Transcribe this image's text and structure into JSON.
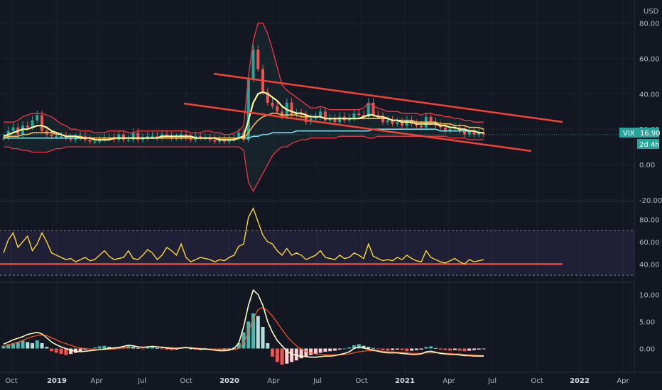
{
  "chart_data": [
    {
      "type": "candlestick",
      "pane": "price",
      "currency": "USD",
      "ylim": [
        -20,
        85
      ],
      "yticks": [
        -20,
        0,
        20,
        40,
        60,
        80
      ],
      "ytick_labels": [
        "-20.00",
        "0.00",
        "20.00",
        "40.00",
        "60.00",
        "80.00"
      ],
      "last_value_symbol": "VIX",
      "last_value": "16.90",
      "time_to_close": "2d 4h",
      "series": [
        {
          "name": "close",
          "values": [
            15,
            19,
            21,
            17,
            22,
            21,
            25,
            28,
            19,
            17,
            16,
            16,
            16,
            15,
            14,
            15,
            16,
            14,
            13,
            13,
            14,
            15,
            15,
            14,
            17,
            14,
            14,
            18,
            14,
            15,
            16,
            16,
            15,
            17,
            16,
            15,
            15,
            17,
            15,
            14,
            16,
            15,
            15,
            14,
            13,
            14,
            13,
            14,
            15,
            18,
            14,
            48,
            65,
            54,
            41,
            35,
            33,
            30,
            27,
            35,
            28,
            29,
            28,
            24,
            26,
            27,
            30,
            25,
            26,
            24,
            27,
            25,
            26,
            29,
            28,
            27,
            35,
            28,
            27,
            24,
            25,
            23,
            24,
            22,
            25,
            23,
            22,
            21,
            27,
            24,
            22,
            21,
            19,
            20,
            21,
            19,
            17,
            19,
            17,
            18,
            17
          ]
        },
        {
          "name": "bb_upper",
          "values": [
            24,
            24,
            24,
            25,
            27,
            28,
            29,
            29,
            29,
            28,
            27,
            25,
            23,
            22,
            20,
            20,
            19,
            19,
            19,
            18,
            18,
            18,
            19,
            19,
            19,
            19,
            18,
            18,
            19,
            19,
            19,
            19,
            19,
            19,
            19,
            19,
            19,
            19,
            19,
            18,
            18,
            18,
            19,
            19,
            18,
            18,
            17,
            17,
            18,
            19,
            22,
            50,
            70,
            80,
            80,
            74,
            65,
            55,
            45,
            42,
            40,
            38,
            36,
            34,
            32,
            32,
            33,
            32,
            31,
            31,
            31,
            31,
            31,
            31,
            31,
            32,
            35,
            33,
            32,
            31,
            30,
            30,
            30,
            29,
            29,
            29,
            29,
            28,
            29,
            29,
            28,
            28,
            27,
            27,
            26,
            26,
            25,
            25,
            24,
            24,
            24
          ]
        },
        {
          "name": "bb_lower",
          "values": [
            10,
            10,
            9,
            9,
            8,
            8,
            7,
            7,
            7,
            7,
            8,
            9,
            9,
            10,
            10,
            10,
            10,
            10,
            10,
            10,
            10,
            10,
            10,
            10,
            10,
            10,
            10,
            10,
            10,
            10,
            10,
            10,
            10,
            10,
            10,
            10,
            10,
            10,
            10,
            10,
            10,
            10,
            10,
            10,
            10,
            10,
            10,
            10,
            10,
            10,
            8,
            -10,
            -15,
            -10,
            -5,
            0,
            5,
            8,
            10,
            10,
            12,
            13,
            14,
            14,
            15,
            15,
            15,
            15,
            15,
            15,
            16,
            16,
            16,
            16,
            16,
            16,
            15,
            15,
            16,
            16,
            16,
            16,
            16,
            16,
            16,
            16,
            16,
            16,
            16,
            16,
            16,
            16,
            16,
            15,
            15,
            15,
            15,
            14,
            14,
            14,
            14
          ]
        },
        {
          "name": "ma_fast",
          "values": [
            16,
            17,
            18,
            19,
            20,
            20,
            21,
            22,
            22,
            21,
            19,
            18,
            17,
            16,
            16,
            16,
            15,
            15,
            15,
            14,
            14,
            14,
            14,
            15,
            15,
            15,
            15,
            15,
            15,
            15,
            15,
            15,
            15,
            16,
            16,
            16,
            16,
            16,
            16,
            16,
            15,
            15,
            15,
            15,
            15,
            14,
            14,
            14,
            14,
            15,
            16,
            25,
            35,
            40,
            41,
            40,
            38,
            36,
            33,
            31,
            30,
            29,
            29,
            28,
            27,
            27,
            27,
            26,
            26,
            26,
            26,
            26,
            26,
            26,
            26,
            27,
            28,
            28,
            27,
            27,
            26,
            25,
            25,
            24,
            24,
            24,
            23,
            23,
            23,
            23,
            23,
            22,
            22,
            21,
            21,
            20,
            20,
            19,
            19,
            18,
            18
          ]
        },
        {
          "name": "ma_slow",
          "values": [
            15,
            16,
            16,
            16,
            17,
            17,
            18,
            18,
            18,
            18,
            18,
            17,
            17,
            16,
            16,
            16,
            16,
            15,
            15,
            15,
            15,
            15,
            15,
            15,
            15,
            15,
            15,
            15,
            15,
            15,
            15,
            15,
            15,
            15,
            15,
            15,
            15,
            15,
            15,
            15,
            15,
            15,
            15,
            15,
            15,
            15,
            15,
            15,
            15,
            15,
            15,
            18,
            22,
            25,
            27,
            28,
            29,
            29,
            28,
            28,
            28,
            28,
            27,
            27,
            27,
            27,
            27,
            26,
            26,
            26,
            26,
            26,
            26,
            26,
            26,
            26,
            26,
            26,
            26,
            26,
            26,
            25,
            25,
            25,
            25,
            25,
            24,
            24,
            24,
            24,
            24,
            23,
            23,
            23,
            22,
            22,
            22,
            21,
            21,
            21,
            20
          ]
        },
        {
          "name": "ma_long",
          "values": [
            15,
            15,
            15,
            15,
            15,
            15,
            15,
            15,
            15,
            15,
            15,
            15,
            15,
            15,
            15,
            15,
            15,
            15,
            15,
            15,
            15,
            15,
            15,
            15,
            15,
            15,
            15,
            15,
            15,
            15,
            15,
            15,
            15,
            15,
            15,
            15,
            15,
            15,
            15,
            15,
            15,
            15,
            15,
            15,
            15,
            15,
            15,
            15,
            15,
            15,
            15,
            15,
            16,
            16,
            17,
            17,
            18,
            18,
            18,
            18,
            18,
            19,
            19,
            19,
            19,
            19,
            19,
            19,
            19,
            19,
            19,
            19,
            19,
            19,
            19,
            19,
            19,
            20,
            20,
            20,
            20,
            20,
            20,
            20,
            20,
            20,
            20,
            20,
            20,
            20,
            20,
            19,
            19,
            19,
            19,
            19,
            19,
            19,
            19,
            18,
            18
          ]
        }
      ]
    },
    {
      "type": "line",
      "pane": "rsi",
      "ylim": [
        25,
        95
      ],
      "yticks": [
        40,
        60,
        80
      ],
      "ytick_labels": [
        "40.00",
        "60.00",
        "80.00"
      ],
      "band_upper": 70,
      "band_lower": 30,
      "reference_level": 40,
      "values": [
        50,
        62,
        68,
        55,
        60,
        65,
        52,
        58,
        68,
        60,
        50,
        48,
        46,
        44,
        45,
        42,
        44,
        46,
        43,
        44,
        48,
        52,
        47,
        44,
        45,
        46,
        52,
        45,
        44,
        48,
        53,
        50,
        44,
        48,
        55,
        52,
        48,
        58,
        46,
        42,
        44,
        46,
        45,
        44,
        42,
        44,
        43,
        46,
        48,
        56,
        58,
        82,
        90,
        78,
        66,
        60,
        58,
        52,
        48,
        54,
        48,
        50,
        48,
        44,
        46,
        48,
        52,
        46,
        45,
        44,
        48,
        45,
        46,
        50,
        48,
        45,
        58,
        47,
        45,
        43,
        44,
        43,
        46,
        44,
        48,
        45,
        43,
        42,
        52,
        46,
        44,
        42,
        41,
        43,
        45,
        42,
        40,
        44,
        42,
        43,
        44
      ]
    },
    {
      "type": "bar+line",
      "pane": "macd",
      "ylim": [
        -4,
        12
      ],
      "yticks": [
        0,
        5,
        10
      ],
      "ytick_labels": [
        "0.00",
        "5.00",
        "10.00"
      ],
      "series": [
        {
          "name": "histogram",
          "values": [
            0.5,
            0.8,
            1,
            1.2,
            1.5,
            1.2,
            1,
            1.5,
            1,
            0.3,
            -0.5,
            -0.8,
            -1,
            -1.2,
            -1,
            -0.8,
            -0.5,
            -0.2,
            0,
            0.2,
            0.4,
            0.5,
            0.3,
            0.1,
            0.2,
            0.4,
            0.6,
            0.3,
            0.1,
            -0.1,
            0.2,
            0.3,
            0.1,
            -0.1,
            -0.2,
            -0.3,
            -0.2,
            0.1,
            0.2,
            0,
            -0.2,
            -0.3,
            -0.2,
            -0.1,
            -0.2,
            -0.3,
            -0.2,
            -0.1,
            0.2,
            1,
            3,
            5,
            6.5,
            6,
            4,
            1,
            -1.5,
            -2.5,
            -3,
            -2.8,
            -2.5,
            -2.2,
            -1.8,
            -1.5,
            -1.2,
            -1,
            -0.8,
            -0.6,
            -0.5,
            -0.4,
            -0.2,
            0,
            0.2,
            0.6,
            0.8,
            0.5,
            0.3,
            0.1,
            -0.1,
            -0.3,
            -0.4,
            -0.3,
            -0.2,
            -0.3,
            -0.5,
            -0.4,
            -0.3,
            -0.2,
            0.3,
            0.4,
            0.1,
            -0.2,
            -0.3,
            -0.4,
            -0.3,
            -0.4,
            -0.5,
            -0.4,
            -0.3,
            -0.2,
            -0.1
          ]
        },
        {
          "name": "macd",
          "values": [
            0.8,
            1.2,
            1.6,
            1.9,
            2.2,
            2.6,
            2.8,
            3,
            2.7,
            2,
            1.2,
            0.7,
            0.3,
            0,
            -0.3,
            -0.5,
            -0.6,
            -0.5,
            -0.4,
            -0.3,
            -0.2,
            -0.1,
            0,
            0.1,
            0.2,
            0.4,
            0.6,
            0.5,
            0.3,
            0.2,
            0.3,
            0.4,
            0.3,
            0.2,
            0.1,
            0,
            0,
            0.1,
            0.2,
            0.1,
            0,
            -0.1,
            -0.1,
            -0.2,
            -0.3,
            -0.4,
            -0.4,
            -0.3,
            0,
            1,
            4,
            8,
            10.8,
            10,
            8,
            5,
            3,
            1.5,
            0.5,
            -0.5,
            -1,
            -1.3,
            -1.4,
            -1.5,
            -1.6,
            -1.6,
            -1.5,
            -1.4,
            -1.4,
            -1.3,
            -1.1,
            -0.9,
            -0.6,
            0,
            0.3,
            0.1,
            -0.1,
            -0.3,
            -0.5,
            -0.7,
            -0.8,
            -0.8,
            -0.8,
            -0.9,
            -1,
            -1.1,
            -1.1,
            -1,
            -0.6,
            -0.5,
            -0.7,
            -0.9,
            -1,
            -1.1,
            -1.1,
            -1.2,
            -1.3,
            -1.3,
            -1.4,
            -1.4,
            -1.4
          ]
        },
        {
          "name": "signal",
          "values": [
            0.3,
            0.6,
            0.9,
            1.2,
            1.5,
            1.9,
            2.2,
            2.4,
            2.5,
            2.4,
            2,
            1.6,
            1.2,
            0.9,
            0.6,
            0.3,
            0.1,
            0,
            -0.1,
            -0.2,
            -0.2,
            -0.2,
            -0.1,
            -0.1,
            0,
            0.1,
            0.2,
            0.3,
            0.3,
            0.3,
            0.3,
            0.3,
            0.3,
            0.3,
            0.2,
            0.2,
            0.1,
            0.1,
            0.1,
            0.1,
            0.1,
            0,
            0,
            -0.1,
            -0.1,
            -0.2,
            -0.2,
            -0.2,
            -0.2,
            0,
            1,
            3,
            5.5,
            7.2,
            7.6,
            7,
            6,
            4.8,
            3.5,
            2.3,
            1.3,
            0.5,
            -0.1,
            -0.5,
            -0.8,
            -1,
            -1.1,
            -1.2,
            -1.2,
            -1.2,
            -1.2,
            -1.1,
            -1,
            -0.8,
            -0.6,
            -0.5,
            -0.4,
            -0.4,
            -0.4,
            -0.5,
            -0.6,
            -0.6,
            -0.7,
            -0.7,
            -0.8,
            -0.9,
            -0.9,
            -0.9,
            -0.8,
            -0.8,
            -0.8,
            -0.8,
            -0.9,
            -0.9,
            -1,
            -1,
            -1.1,
            -1.2,
            -1.2,
            -1.3,
            -1.3
          ]
        }
      ]
    }
  ],
  "x_axis": {
    "tick_labels": [
      {
        "text": "Oct",
        "bold": false
      },
      {
        "text": "2019",
        "bold": true
      },
      {
        "text": "Apr",
        "bold": false
      },
      {
        "text": "Jul",
        "bold": false
      },
      {
        "text": "Oct",
        "bold": false
      },
      {
        "text": "2020",
        "bold": true
      },
      {
        "text": "Apr",
        "bold": false
      },
      {
        "text": "Jul",
        "bold": false
      },
      {
        "text": "Oct",
        "bold": false
      },
      {
        "text": "2021",
        "bold": true
      },
      {
        "text": "Apr",
        "bold": false
      },
      {
        "text": "Jul",
        "bold": false
      },
      {
        "text": "Oct",
        "bold": false
      },
      {
        "text": "2022",
        "bold": true
      },
      {
        "text": "Apr",
        "bold": false
      }
    ]
  },
  "colors": {
    "background": "#131722",
    "grid": "#1e222d",
    "text": "#b2b5be",
    "up": "#26a69a",
    "down": "#ef5350",
    "bollinger": "#f23645",
    "ma_fast": "#fff59d",
    "ma_slow": "#ffb74d",
    "ma_long": "#80deea",
    "rsi_line": "#fdd835",
    "rsi_band": "#7e57c2",
    "macd_line": "#fff9c4",
    "signal_line": "#ff5722",
    "hist_pos": "#4db6ac",
    "hist_neg": "#ef5350",
    "trendline": "#f44336",
    "last_badge": "#26a69a"
  }
}
